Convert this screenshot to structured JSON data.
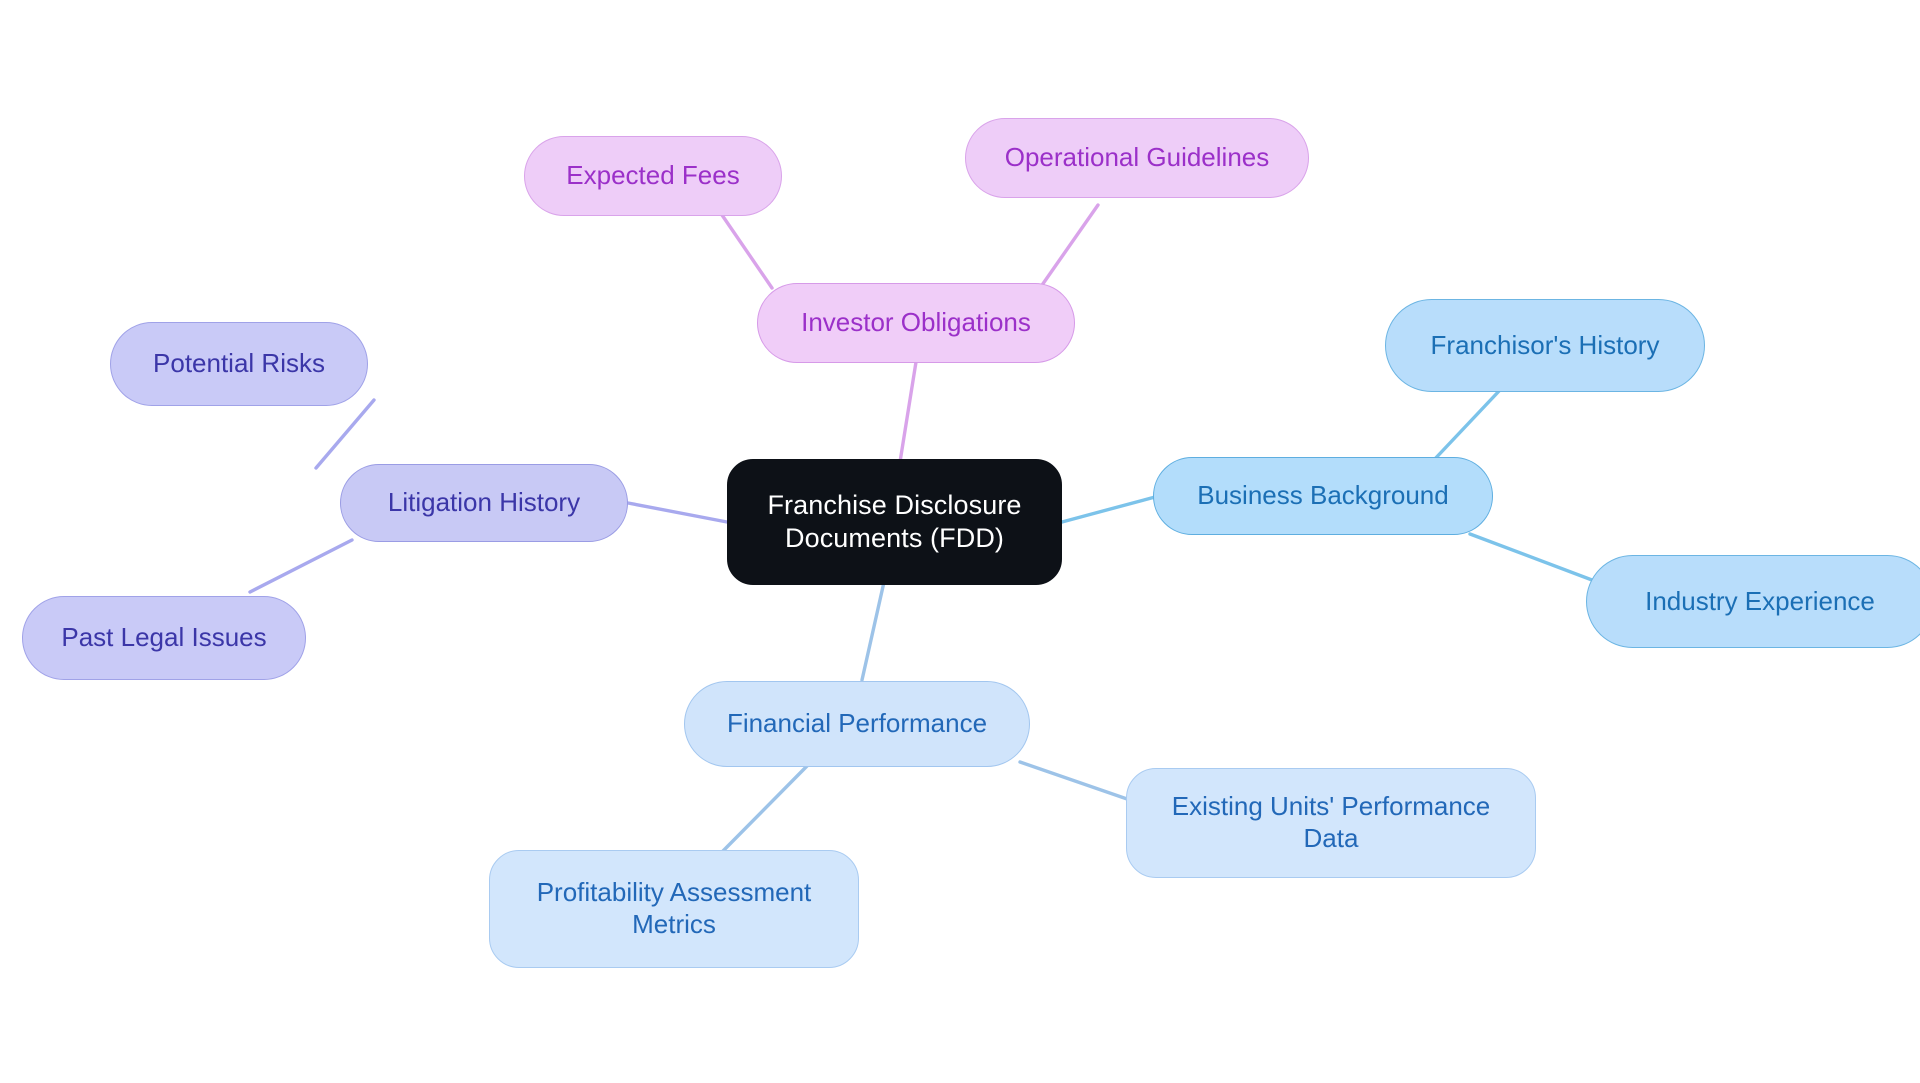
{
  "diagram": {
    "type": "mindmap",
    "title": "Franchise Disclosure Documents (FDD)",
    "background": "#ffffff",
    "root": {
      "id": "root",
      "label": "Franchise Disclosure\nDocuments (FDD)",
      "fill": "#0d1117",
      "text_color": "#ffffff"
    },
    "branches": [
      {
        "id": "business-background",
        "label": "Business Background",
        "fill": "#b3ddfb",
        "border": "#5eaee0",
        "text_color": "#1b6fb5",
        "edge_color": "#7cc3ea",
        "children": [
          {
            "id": "franchisors-history",
            "label": "Franchisor's History",
            "fill": "#b8ddfb",
            "border": "#6cb5e3",
            "text_color": "#1b6fb5"
          },
          {
            "id": "industry-experience",
            "label": "Industry Experience",
            "fill": "#b8ddfb",
            "border": "#6cb5e3",
            "text_color": "#1b6fb5"
          }
        ]
      },
      {
        "id": "financial-performance",
        "label": "Financial Performance",
        "fill": "#d0e4fb",
        "border": "#a2c6ef",
        "text_color": "#2268b8",
        "edge_color": "#9dc3e8",
        "children": [
          {
            "id": "existing-units-performance-data",
            "label": "Existing Units' Performance\nData",
            "fill": "#d2e6fc",
            "border": "#a9cbf1",
            "text_color": "#2268b8"
          },
          {
            "id": "profitability-assessment-metrics",
            "label": "Profitability Assessment\nMetrics",
            "fill": "#d2e6fc",
            "border": "#a9cbf1",
            "text_color": "#2268b8"
          }
        ]
      },
      {
        "id": "litigation-history",
        "label": "Litigation History",
        "fill": "#c8c9f5",
        "border": "#9a9ce4",
        "text_color": "#3b36a8",
        "edge_color": "#a8a9ee",
        "children": [
          {
            "id": "potential-risks",
            "label": "Potential Risks",
            "fill": "#c9caf7",
            "border": "#a0a2e8",
            "text_color": "#3b36a8"
          },
          {
            "id": "past-legal-issues",
            "label": "Past Legal Issues",
            "fill": "#c9caf7",
            "border": "#a0a2e8",
            "text_color": "#3b36a8"
          }
        ]
      },
      {
        "id": "investor-obligations",
        "label": "Investor Obligations",
        "fill": "#f0cdf8",
        "border": "#d69ae8",
        "text_color": "#9b30c9",
        "edge_color": "#d9a3ea",
        "children": [
          {
            "id": "expected-fees",
            "label": "Expected Fees",
            "fill": "#eecdf8",
            "border": "#d9a3ea",
            "text_color": "#9b30c9"
          },
          {
            "id": "operational-guidelines",
            "label": "Operational Guidelines",
            "fill": "#eecdf8",
            "border": "#d9a3ea",
            "text_color": "#9b30c9"
          }
        ]
      }
    ]
  }
}
